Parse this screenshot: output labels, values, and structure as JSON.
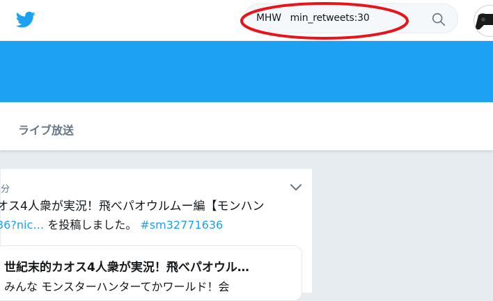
{
  "search": {
    "query": "MHW   min_retweets:30"
  },
  "nav": {
    "tab_live": "ライブ放送"
  },
  "tweet": {
    "time": "分",
    "line1": "オス4人衆が実況！飛べパオウルムー編【モンハン",
    "link_url": "36?nic…",
    "line2_text": " を投稿しました。 ",
    "hashtag": "#sm32771636",
    "card_title": "世紀末的カオス4人衆が実況！飛べパオウル…",
    "card_desc": "みんな モンスターハンターてかワールド！会"
  },
  "colors": {
    "brand": "#1da1f2",
    "annotation": "#e8141c"
  }
}
